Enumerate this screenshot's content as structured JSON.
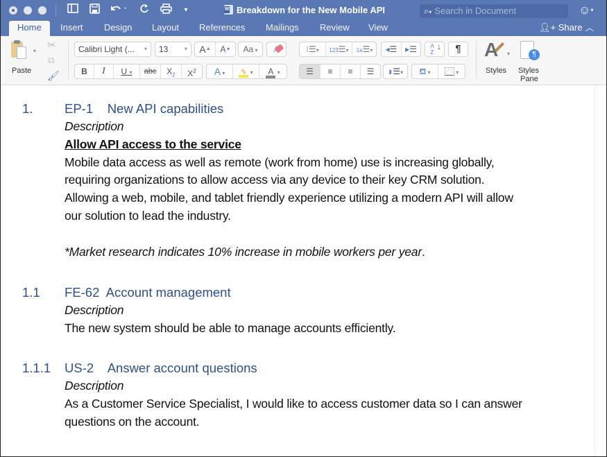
{
  "window": {
    "title": "Breakdown for the New Mobile API",
    "search_placeholder": "Search in Document",
    "quick_access": [
      "sidebar-icon",
      "save-icon",
      "undo-icon",
      "redo-icon",
      "print-icon",
      "customize-icon"
    ],
    "account_icon": "smiley-icon"
  },
  "tabs": [
    {
      "label": "Home",
      "active": true
    },
    {
      "label": "Insert"
    },
    {
      "label": "Design"
    },
    {
      "label": "Layout"
    },
    {
      "label": "References"
    },
    {
      "label": "Mailings"
    },
    {
      "label": "Review"
    },
    {
      "label": "View"
    }
  ],
  "share_label": "Share",
  "ribbon": {
    "paste_label": "Paste",
    "font_name": "Calibri Light (...",
    "font_size": "13",
    "grow_font": "A",
    "shrink_font": "A",
    "change_case": "Aa",
    "bold": "B",
    "italic": "I",
    "underline": "U",
    "strikethrough": "abc",
    "subscript": "X",
    "subscript_sub": "2",
    "superscript": "X",
    "superscript_sup": "2",
    "text_effects": "A",
    "font_color": "A",
    "sort": "A Z",
    "show_marks": "¶",
    "styles_label": "Styles",
    "styles_pane_label_1": "Styles",
    "styles_pane_label_2": "Pane",
    "highlight_color": "#f5e94a",
    "font_color_bar": "#8a8a8a"
  },
  "document": {
    "sections": [
      {
        "number": "1.",
        "heading": "EP-1    New API capabilities",
        "label": "Description",
        "subheading": "Allow API access to the service",
        "body": [
          "Mobile data access as well as remote (work from home) use is increasing globally,",
          "requiring organizations to allow access via any device to their key CRM solution.",
          "Allowing a web, mobile, and tablet friendly experience utilizing a modern API will allow",
          "our solution to lead the industry."
        ],
        "note": "*Market research indicates 10% increase in mobile workers per year",
        "note_end": "."
      },
      {
        "number": "1.1",
        "heading": "FE-62  Account management",
        "label": "Description",
        "body": [
          "The new system should be able to manage accounts efficiently."
        ]
      },
      {
        "number": "1.1.1",
        "heading": "US-2    Answer account questions",
        "label": "Description",
        "body": [
          "As a Customer Service Specialist, I would like to access customer data so I can answer",
          "questions on the account."
        ]
      }
    ]
  },
  "colors": {
    "titlebar": "#5a78b4",
    "heading": "#2f4f8a",
    "ribbon_bg": "#f7f7f7"
  }
}
